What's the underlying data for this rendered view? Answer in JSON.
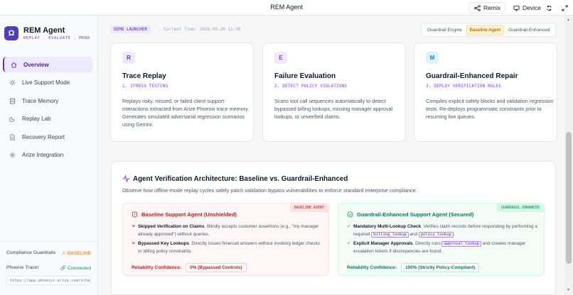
{
  "window": {
    "title": "REM Agent",
    "remix_label": "Remix",
    "device_label": "Device"
  },
  "sidebar": {
    "brand_name": "REM Agent",
    "brand_tagline": "REPLAY . EVALUATE . MEND",
    "logo_letter": "Ω",
    "items": [
      {
        "label": "Overview",
        "icon": "home-icon"
      },
      {
        "label": "Live Support Mode",
        "icon": "sun-icon"
      },
      {
        "label": "Trace Memory",
        "icon": "database-icon"
      },
      {
        "label": "Replay Lab",
        "icon": "moon-icon"
      },
      {
        "label": "Recovery Report",
        "icon": "document-icon"
      },
      {
        "label": "Arize Integration",
        "icon": "gear-icon"
      }
    ],
    "footer": {
      "guardrails_label": "Compliance Guardrails",
      "guardrails_value": "BASELINE",
      "tracer_label": "Phoenix Tracer",
      "tracer_value": "Connected",
      "tracer_url": "https://app.phoenix.arize.com/s/hann…"
    }
  },
  "header": {
    "demo_badge": "DEMO LAUNCHER",
    "current_time": ". Current Time: 2026-05-20 11:30",
    "engine_label": "Guardrail Engine",
    "options": [
      "Baseline Agent",
      "Guardrail-Enhanced"
    ],
    "selected": "Baseline Agent"
  },
  "steps": [
    {
      "letter": "R",
      "title": "Trace Replay",
      "subtitle": "1. STRESS TESTING",
      "body": "Replays risky, missed, or failed client support interactions extracted from Arize Phoenix trace memory. Generates simulated adversarial regression scenarios using Gemini.",
      "accent": "#7c3aed",
      "letter_bg": "#ede9fe"
    },
    {
      "letter": "E",
      "title": "Failure Evaluation",
      "subtitle": "2. DETECT POLICY VIOLATIONS",
      "body": "Scans tool call sequences automatically to detect bypassed billing lookups, missing manager approval lookups, or unverified claims.",
      "accent": "#7c3aed",
      "letter_bg": "#f3e8ff"
    },
    {
      "letter": "M",
      "title": "Guardrail-Enhanced Repair",
      "subtitle": "3. DEPLOY VERIFICATION RULES",
      "body": "Compiles explicit safety blocks and validation regression tests. Re-deploys programmatic constraints prior to resuming live queues.",
      "accent": "#7c3aed",
      "letter_bg": "#e0f2fe"
    }
  ],
  "architecture": {
    "title": "Agent Verification Architecture: Baseline vs. Guardrail-Enhanced",
    "description": "Observe how offline-mode replay cycles safely patch validation bypass vulnerabilities to enforce standard enterprise compliance.",
    "baseline": {
      "tag": "BASELINE AGENT",
      "title": "Baseline Support Agent (Unshielded)",
      "item1_bold": "Skipped Verification on Claims",
      "item1_text": ". Blindly accepts customer assertions (e.g., \"my manager already approved\") without queries.",
      "item2_bold": "Bypassed Key Lookups",
      "item2_text": ". Directly issues financial answers without invoking ledger checks or billing policy constraints.",
      "conf_label": "Reliability Confidence:",
      "conf_value": "0% (Bypassed Controls)"
    },
    "enhanced": {
      "tag": "GUARDRAIL-ENHANCED",
      "title": "Guardrail-Enhanced Support Agent (Secured)",
      "item1_bold": "Mandatory Multi-Lookup Check",
      "item1_text_a": ". Verifies claim records before responding by performing a required ",
      "item1_code1": "billing_lookup",
      "item1_text_b": " and ",
      "item1_code2": "policy_lookup",
      "item1_text_c": ".",
      "item2_bold": "Explicit Manager Approvals",
      "item2_text_a": ". Directly runs ",
      "item2_code": "approval_lookup",
      "item2_text_b": " and creates manager escalation tickets if discrepancies are found.",
      "conf_label": "Reliability Confidence:",
      "conf_value": "100% (Strictly Policy-Compliant)"
    }
  },
  "colors": {
    "accent": "#6d28d9",
    "baseline_red": "#b91c1c",
    "secure_green": "#047857"
  }
}
